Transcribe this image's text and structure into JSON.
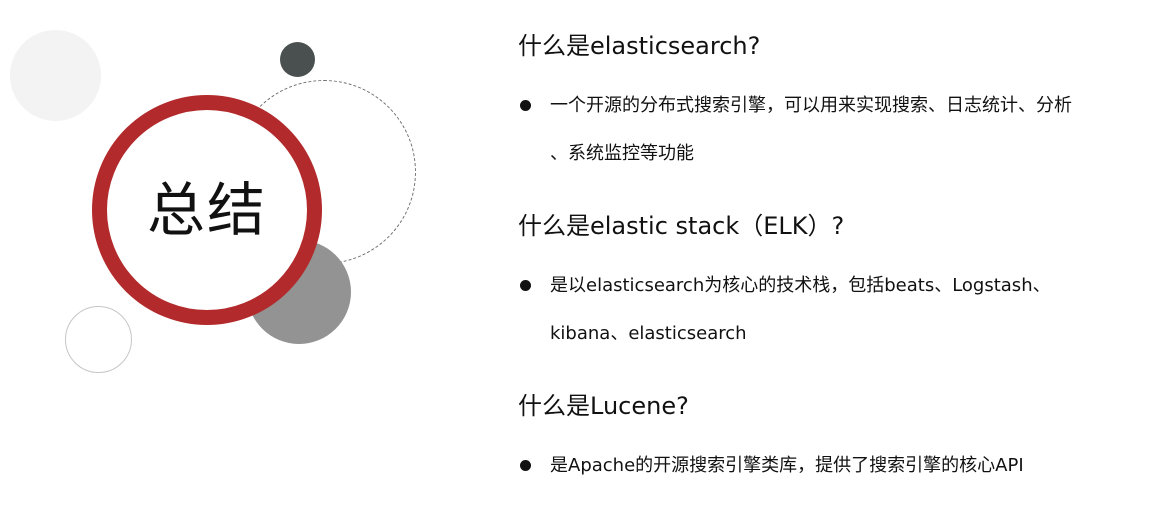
{
  "slide": {
    "title": "总结",
    "sections": [
      {
        "question": "什么是elasticsearch?",
        "bullet_lines": [
          "一个开源的分布式搜索引擎，可以用来实现搜索、日志统计、分析",
          "、系统监控等功能"
        ]
      },
      {
        "question": "什么是elastic stack（ELK）?",
        "bullet_lines": [
          "是以elasticsearch为核心的技术栈，包括beats、Logstash、",
          "kibana、elasticsearch"
        ]
      },
      {
        "question": "什么是Lucene?",
        "bullet_lines": [
          "是Apache的开源搜索引擎类库，提供了搜索引擎的核心API"
        ]
      }
    ]
  },
  "colors": {
    "accent_ring": "#b22a2b",
    "dark_dot": "#4a5050",
    "gray_disc": "#939393",
    "light_disc": "#f3f3f3"
  }
}
